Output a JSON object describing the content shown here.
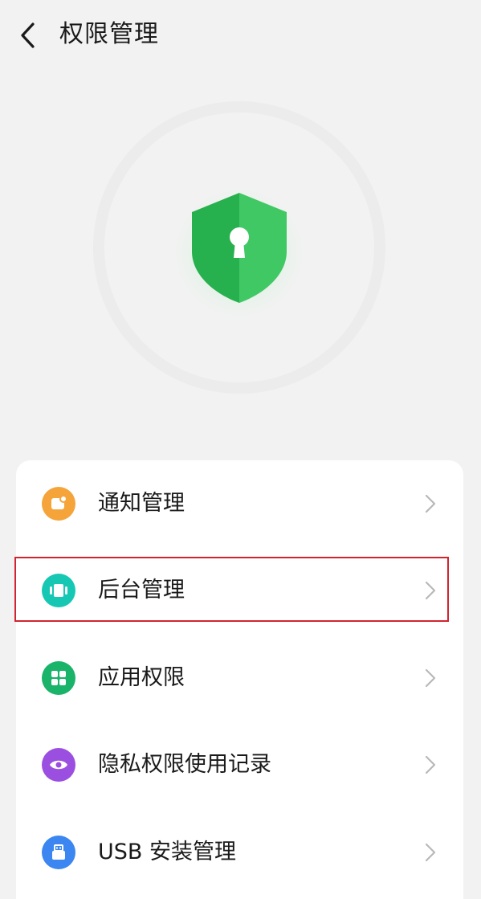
{
  "header": {
    "back_icon": "chevron-left-icon",
    "title": "权限管理"
  },
  "hero": {
    "icon": "shield-keyhole-icon",
    "shield_color": "#2dbb55",
    "ring_color": "#ececec"
  },
  "menu": {
    "items": [
      {
        "label": "通知管理",
        "icon": "notification-icon",
        "icon_color": "#f5a43a"
      },
      {
        "label": "后台管理",
        "icon": "background-apps-icon",
        "icon_color": "#16c8b4"
      },
      {
        "label": "应用权限",
        "icon": "app-grid-icon",
        "icon_color": "#19b36a"
      },
      {
        "label": "隐私权限使用记录",
        "icon": "eye-icon",
        "icon_color": "#9b4fe0"
      },
      {
        "label": "USB 安装管理",
        "icon": "usb-icon",
        "icon_color": "#3b86f0"
      }
    ]
  },
  "colors": {
    "background": "#f2f2f2",
    "card": "#ffffff",
    "highlight_border": "#d1242f",
    "chevron": "#b8b8b8"
  }
}
